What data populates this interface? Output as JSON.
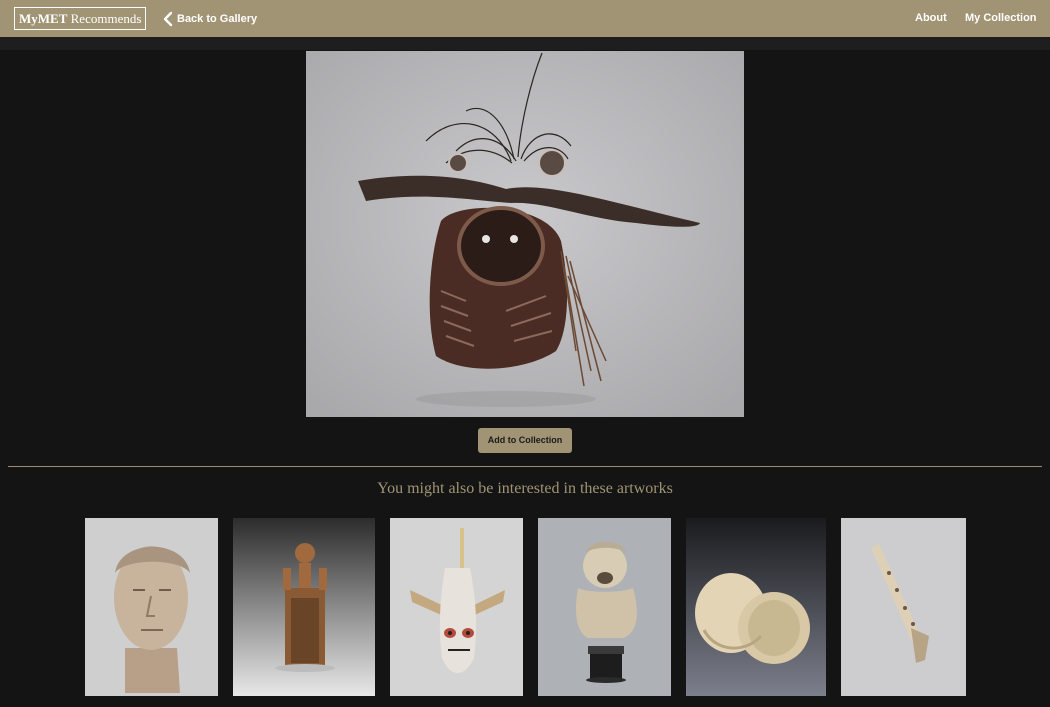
{
  "navbar": {
    "brand_prefix": "MyMET",
    "brand_suffix": "Recommends",
    "back_label": "Back to Gallery",
    "about_label": "About",
    "collection_label": "My Collection"
  },
  "artwork": {
    "image": "mask-with-feathers-artwork",
    "add_label": "Add to Collection"
  },
  "recommendations": {
    "heading": "You might also be interested in these artworks",
    "items": [
      {
        "image": "marble-portrait-head"
      },
      {
        "image": "carved-wooden-figure-seat"
      },
      {
        "image": "painted-bark-mask"
      },
      {
        "image": "grimacing-bust-sculpture"
      },
      {
        "image": "gourd-vessel-halves"
      },
      {
        "image": "carved-ivory-object"
      }
    ]
  },
  "colors": {
    "navbar": "#a19475",
    "background": "#141414",
    "accent": "#a19475"
  }
}
